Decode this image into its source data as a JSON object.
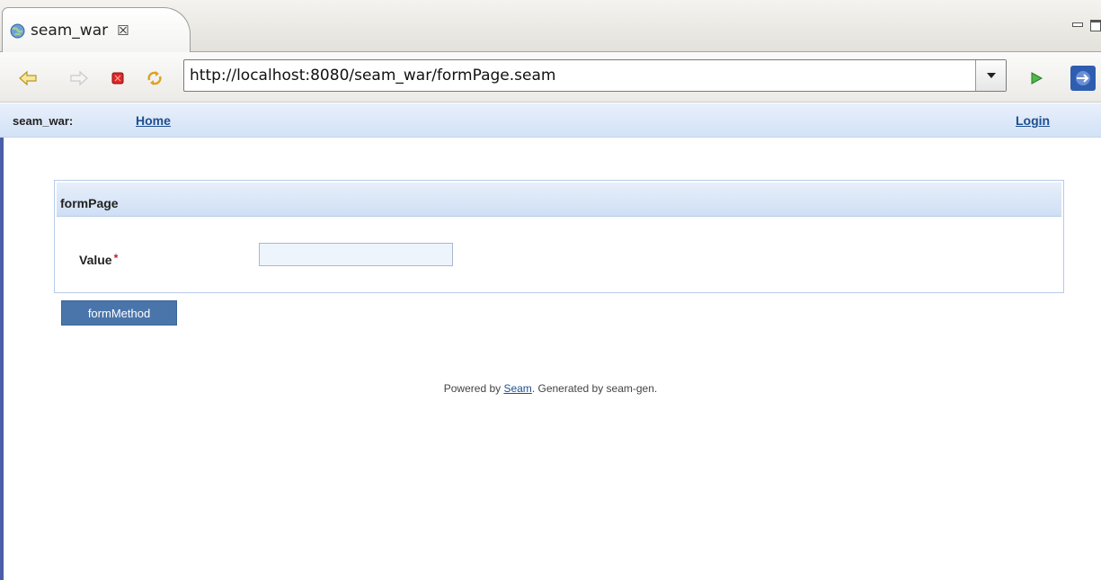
{
  "editor": {
    "tab_title": "seam_war",
    "tab_close_symbol": "☒"
  },
  "browser": {
    "url": "http://localhost:8080/seam_war/formPage.seam",
    "icons": [
      "back-arrow-icon",
      "forward-arrow-icon",
      "stop-icon",
      "refresh-icon",
      "dropdown-icon",
      "go-icon",
      "external-browser-icon"
    ]
  },
  "nav": {
    "brand": "seam_war:",
    "home": "Home",
    "login": "Login"
  },
  "form": {
    "panel_title": "formPage",
    "field_label": "Value",
    "required_marker": "*",
    "field_value": "",
    "submit_label": "formMethod"
  },
  "footer": {
    "prefix": "Powered by ",
    "link": "Seam",
    "suffix": ". Generated by seam-gen."
  },
  "colors": {
    "nav_link": "#1f4f8f",
    "button_bg": "#4a75ab",
    "required": "#c41a1a",
    "panel_border": "#b8cbe8"
  }
}
